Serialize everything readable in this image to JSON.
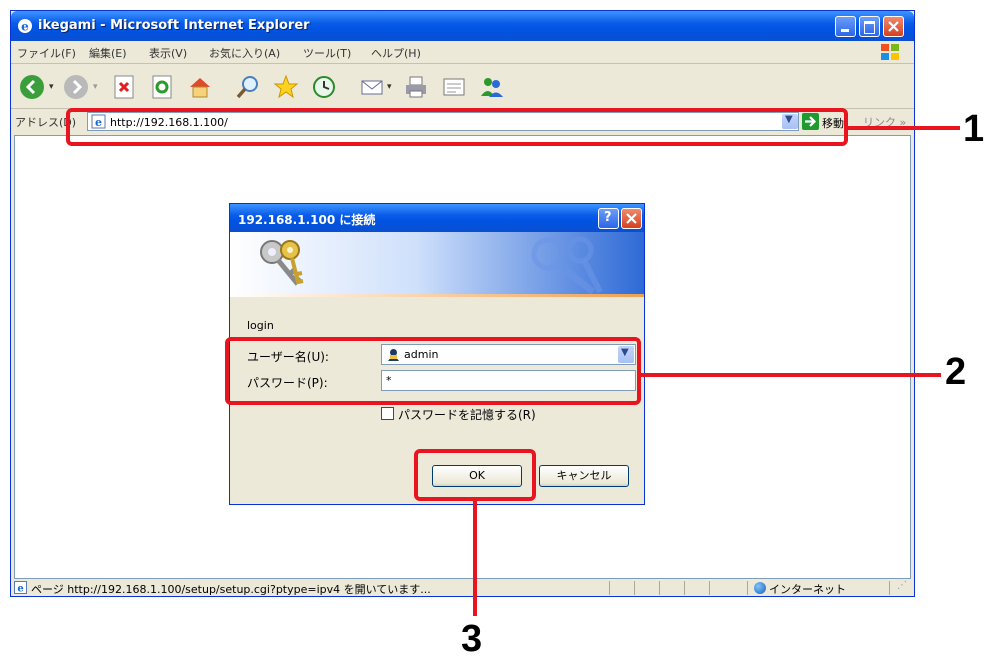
{
  "window": {
    "title": "ikegami - Microsoft Internet Explorer",
    "menu": [
      "ファイル(F)",
      "編集(E)",
      "表示(V)",
      "お気に入り(A)",
      "ツール(T)",
      "ヘルプ(H)"
    ]
  },
  "address_bar": {
    "label": "アドレス(D)",
    "url": "http://192.168.1.100/",
    "go_label": "移動",
    "links_label": "リンク »"
  },
  "dialog": {
    "title": "192.168.1.100 に接続",
    "realm": "login",
    "username_label": "ユーザー名(U):",
    "username_value": "admin",
    "password_label": "パスワード(P):",
    "password_value": "*",
    "remember_label": "パスワードを記憶する(R)",
    "remember_checked": false,
    "ok_label": "OK",
    "cancel_label": "キャンセル"
  },
  "status_bar": {
    "text": "ページ http://192.168.1.100/setup/setup.cgi?ptype=ipv4 を開いています...",
    "zone": "インターネット"
  },
  "callouts": [
    "1",
    "2",
    "3"
  ],
  "colors": {
    "callout": "#e8141f",
    "titlebar": "#0054e3",
    "chrome": "#ece9d8"
  },
  "toolbar_icons": [
    "back-icon",
    "forward-icon",
    "stop-icon",
    "refresh-icon",
    "home-icon",
    "search-icon",
    "favorites-icon",
    "history-icon",
    "mail-icon",
    "print-icon",
    "edit-icon",
    "messenger-icon"
  ]
}
